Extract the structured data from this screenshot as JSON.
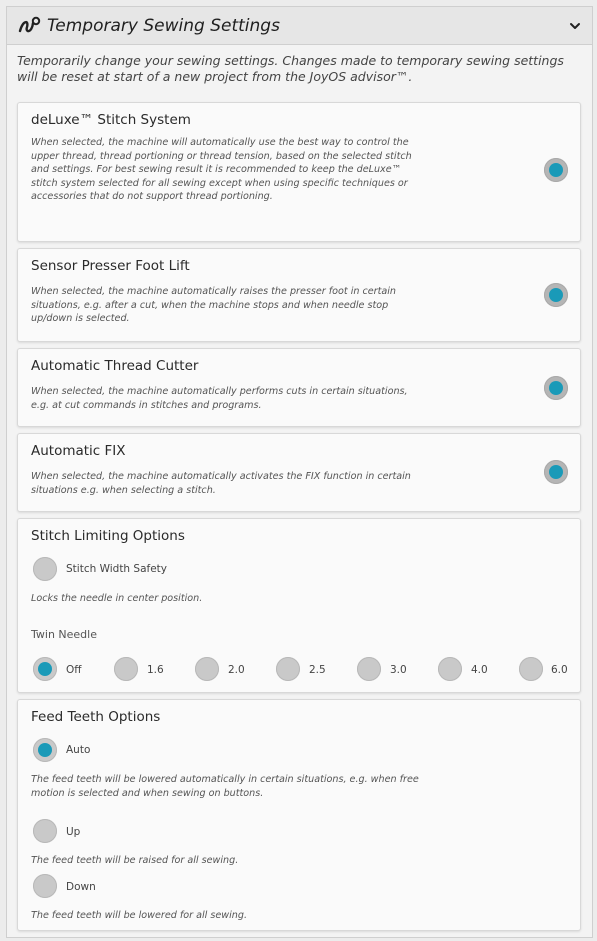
{
  "header": {
    "title": "Temporary Sewing Settings"
  },
  "intro": "Temporarily change your sewing settings. Changes made to temporary sewing settings will be reset at start of a new project from the JoyOS advisor™.",
  "settings": [
    {
      "title": "deLuxe™ Stitch System",
      "description": "When selected, the machine will automatically use the best way to control the upper thread, thread portioning or thread tension, based on the selected stitch and settings. For best sewing result it is recommended to keep the deLuxe™ stitch system selected for all sewing except when using specific techniques or accessories that do not support thread portioning.",
      "enabled": true
    },
    {
      "title": "Sensor Presser Foot Lift",
      "description": "When selected, the machine automatically raises the presser foot in certain situations, e.g. after a cut, when the machine stops and when needle stop up/down is selected.",
      "enabled": true
    },
    {
      "title": "Automatic Thread Cutter",
      "description": "When selected, the machine automatically performs cuts in certain situations, e.g. at cut commands in stitches and programs.",
      "enabled": true
    },
    {
      "title": "Automatic FIX",
      "description": "When selected, the machine automatically activates the FIX function in certain situations e.g. when selecting a stitch.",
      "enabled": true
    }
  ],
  "stitch_limiting": {
    "title": "Stitch Limiting Options",
    "width_safety_label": "Stitch Width Safety",
    "width_safety_note": "Locks the needle in center position.",
    "twin_needle_label": "Twin Needle",
    "twin_needle_options": [
      "Off",
      "1.6",
      "2.0",
      "2.5",
      "3.0",
      "4.0",
      "6.0"
    ],
    "twin_needle_selected": "Off"
  },
  "feed_teeth": {
    "title": "Feed Teeth Options",
    "options": [
      {
        "label": "Auto",
        "note": "The feed teeth will be lowered automatically in certain situations, e.g. when free motion is selected and when sewing on buttons."
      },
      {
        "label": "Up",
        "note": "The feed teeth will be raised for all sewing."
      },
      {
        "label": "Down",
        "note": "The feed teeth will be lowered for all sewing."
      }
    ],
    "selected": "Auto"
  },
  "colors": {
    "accent": "#1a9ab8",
    "off": "#c9c9c9"
  }
}
